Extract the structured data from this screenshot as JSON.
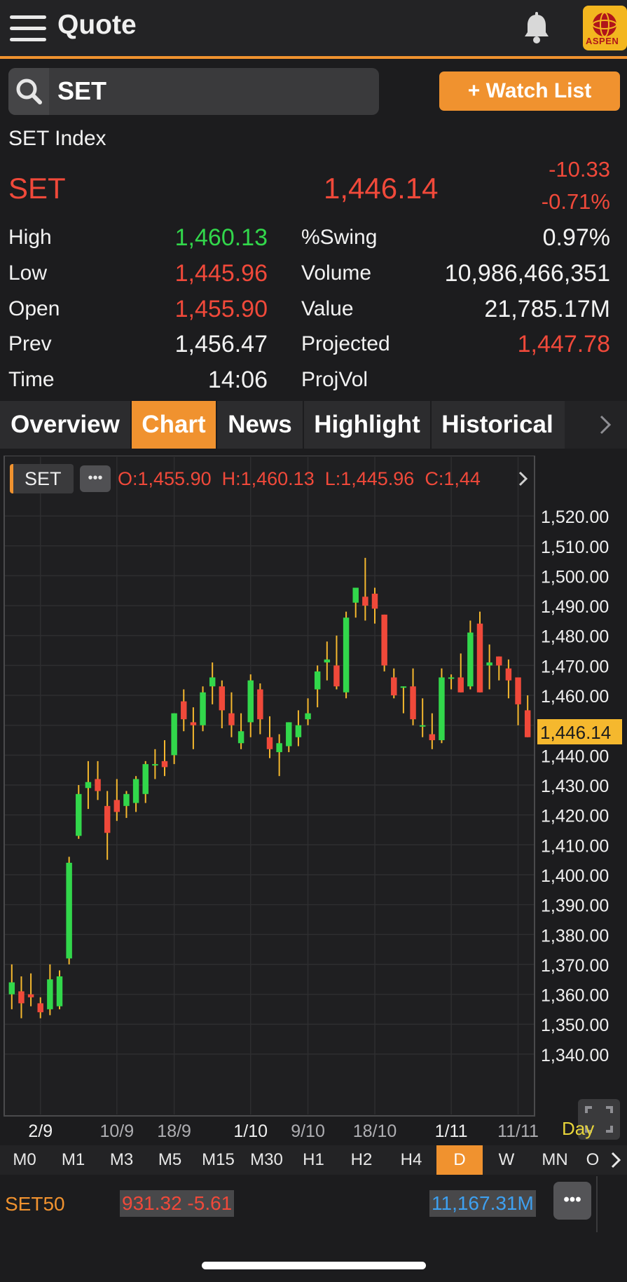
{
  "header": {
    "title": "Quote",
    "logo_text": "ASPEN"
  },
  "search": {
    "value": "SET"
  },
  "watchlist_button": "+ Watch List",
  "security_name": "SET Index",
  "quote": {
    "symbol": "SET",
    "last": "1,446.14",
    "change": "-10.33",
    "percent_change": "-0.71%"
  },
  "stats": {
    "high_label": "High",
    "high": "1,460.13",
    "low_label": "Low",
    "low": "1,445.96",
    "open_label": "Open",
    "open": "1,455.90",
    "prev_label": "Prev",
    "prev": "1,456.47",
    "time_label": "Time",
    "time": "14:06",
    "swing_label": "%Swing",
    "swing": "0.97%",
    "volume_label": "Volume",
    "volume": "10,986,466,351",
    "value_label": "Value",
    "value": "21,785.17M",
    "projected_label": "Projected",
    "projected": "1,447.78",
    "projvol_label": "ProjVol",
    "projvol": ""
  },
  "tabs": [
    "Overview",
    "Chart",
    "News",
    "Highlight",
    "Historical"
  ],
  "active_tab": "Chart",
  "chart_legend": {
    "symbol": "SET",
    "more": "•••",
    "ohlc": "O:1,455.90  H:1,460.13  L:1,445.96  C:1,44"
  },
  "chart_data": {
    "type": "candlestick",
    "ylim": [
      1332,
      1528
    ],
    "y_ticks": [
      "1,520.00",
      "1,510.00",
      "1,500.00",
      "1,490.00",
      "1,480.00",
      "1,470.00",
      "1,460.00",
      "1,450.00",
      "1,440.00",
      "1,430.00",
      "1,420.00",
      "1,410.00",
      "1,400.00",
      "1,390.00",
      "1,380.00",
      "1,370.00",
      "1,360.00",
      "1,350.00",
      "1,340.00"
    ],
    "x_ticks": [
      "2/9",
      "10/9",
      "18/9",
      "1/10",
      "9/10",
      "18/10",
      "1/11",
      "11/11"
    ],
    "x_tick_index": [
      3,
      11,
      17,
      25,
      31,
      38,
      46,
      53
    ],
    "current_price": "1,446.14",
    "period_label": "Day",
    "candles": [
      {
        "o": 1360,
        "h": 1370,
        "l": 1355,
        "c": 1364
      },
      {
        "o": 1361,
        "h": 1366,
        "l": 1352,
        "c": 1357
      },
      {
        "o": 1360,
        "h": 1367,
        "l": 1356,
        "c": 1359
      },
      {
        "o": 1357,
        "h": 1359,
        "l": 1352,
        "c": 1354
      },
      {
        "o": 1355,
        "h": 1370,
        "l": 1353,
        "c": 1365
      },
      {
        "o": 1356,
        "h": 1368,
        "l": 1355,
        "c": 1366
      },
      {
        "o": 1372,
        "h": 1406,
        "l": 1370,
        "c": 1404
      },
      {
        "o": 1413,
        "h": 1430,
        "l": 1412,
        "c": 1427
      },
      {
        "o": 1429,
        "h": 1438,
        "l": 1422,
        "c": 1431
      },
      {
        "o": 1432,
        "h": 1438,
        "l": 1425,
        "c": 1428
      },
      {
        "o": 1423,
        "h": 1428,
        "l": 1405,
        "c": 1414
      },
      {
        "o": 1425,
        "h": 1432,
        "l": 1418,
        "c": 1421
      },
      {
        "o": 1423,
        "h": 1428,
        "l": 1419,
        "c": 1427
      },
      {
        "o": 1424,
        "h": 1433,
        "l": 1421,
        "c": 1432
      },
      {
        "o": 1427,
        "h": 1438,
        "l": 1424,
        "c": 1437
      },
      {
        "o": 1437,
        "h": 1442,
        "l": 1432,
        "c": 1437
      },
      {
        "o": 1438,
        "h": 1445,
        "l": 1433,
        "c": 1436
      },
      {
        "o": 1440,
        "h": 1454,
        "l": 1437,
        "c": 1454
      },
      {
        "o": 1458,
        "h": 1462,
        "l": 1448,
        "c": 1452
      },
      {
        "o": 1451,
        "h": 1456,
        "l": 1442,
        "c": 1450
      },
      {
        "o": 1450,
        "h": 1463,
        "l": 1448,
        "c": 1461
      },
      {
        "o": 1463,
        "h": 1471,
        "l": 1457,
        "c": 1466
      },
      {
        "o": 1463,
        "h": 1465,
        "l": 1449,
        "c": 1455
      },
      {
        "o": 1454,
        "h": 1461,
        "l": 1446,
        "c": 1450
      },
      {
        "o": 1444,
        "h": 1454,
        "l": 1442,
        "c": 1448
      },
      {
        "o": 1451,
        "h": 1467,
        "l": 1446,
        "c": 1465
      },
      {
        "o": 1462,
        "h": 1464,
        "l": 1447,
        "c": 1452
      },
      {
        "o": 1446,
        "h": 1453,
        "l": 1439,
        "c": 1442
      },
      {
        "o": 1441,
        "h": 1447,
        "l": 1433,
        "c": 1444
      },
      {
        "o": 1443,
        "h": 1451,
        "l": 1441,
        "c": 1451
      },
      {
        "o": 1446,
        "h": 1455,
        "l": 1443,
        "c": 1450
      },
      {
        "o": 1452,
        "h": 1459,
        "l": 1450,
        "c": 1454
      },
      {
        "o": 1462,
        "h": 1470,
        "l": 1456,
        "c": 1468
      },
      {
        "o": 1471,
        "h": 1478,
        "l": 1465,
        "c": 1472
      },
      {
        "o": 1470,
        "h": 1480,
        "l": 1462,
        "c": 1463
      },
      {
        "o": 1461,
        "h": 1488,
        "l": 1459,
        "c": 1486
      },
      {
        "o": 1491,
        "h": 1496,
        "l": 1486,
        "c": 1496
      },
      {
        "o": 1493,
        "h": 1506,
        "l": 1485,
        "c": 1490
      },
      {
        "o": 1494,
        "h": 1496,
        "l": 1484,
        "c": 1489
      },
      {
        "o": 1487,
        "h": 1487,
        "l": 1468,
        "c": 1470
      },
      {
        "o": 1466,
        "h": 1469,
        "l": 1459,
        "c": 1460
      },
      {
        "o": 1463,
        "h": 1463,
        "l": 1454,
        "c": 1463
      },
      {
        "o": 1463,
        "h": 1469,
        "l": 1450,
        "c": 1452
      },
      {
        "o": 1450,
        "h": 1459,
        "l": 1446,
        "c": 1450
      },
      {
        "o": 1447,
        "h": 1454,
        "l": 1442,
        "c": 1445
      },
      {
        "o": 1445,
        "h": 1469,
        "l": 1444,
        "c": 1466
      },
      {
        "o": 1466,
        "h": 1467,
        "l": 1462,
        "c": 1466
      },
      {
        "o": 1466,
        "h": 1474,
        "l": 1462,
        "c": 1461
      },
      {
        "o": 1463,
        "h": 1485,
        "l": 1462,
        "c": 1481
      },
      {
        "o": 1484,
        "h": 1488,
        "l": 1461,
        "c": 1461
      },
      {
        "o": 1470,
        "h": 1477,
        "l": 1462,
        "c": 1471
      },
      {
        "o": 1473,
        "h": 1472,
        "l": 1465,
        "c": 1470
      },
      {
        "o": 1469,
        "h": 1472,
        "l": 1459,
        "c": 1465
      },
      {
        "o": 1466,
        "h": 1464,
        "l": 1450,
        "c": 1457
      },
      {
        "o": 1455,
        "h": 1460,
        "l": 1446,
        "c": 1446
      }
    ]
  },
  "timeframes": [
    "M0",
    "M1",
    "M3",
    "M5",
    "M15",
    "M30",
    "H1",
    "H2",
    "H4",
    "D",
    "W",
    "MN",
    "O"
  ],
  "active_timeframe": "D",
  "ticker": {
    "symbol": "SET50",
    "price_change": "931.32 -5.61",
    "value": "11,167.31M",
    "more": "•••"
  },
  "colors": {
    "accent": "#f0922f",
    "up": "#32d74b",
    "down": "#f0493a",
    "price_tag": "#f5b82e"
  }
}
